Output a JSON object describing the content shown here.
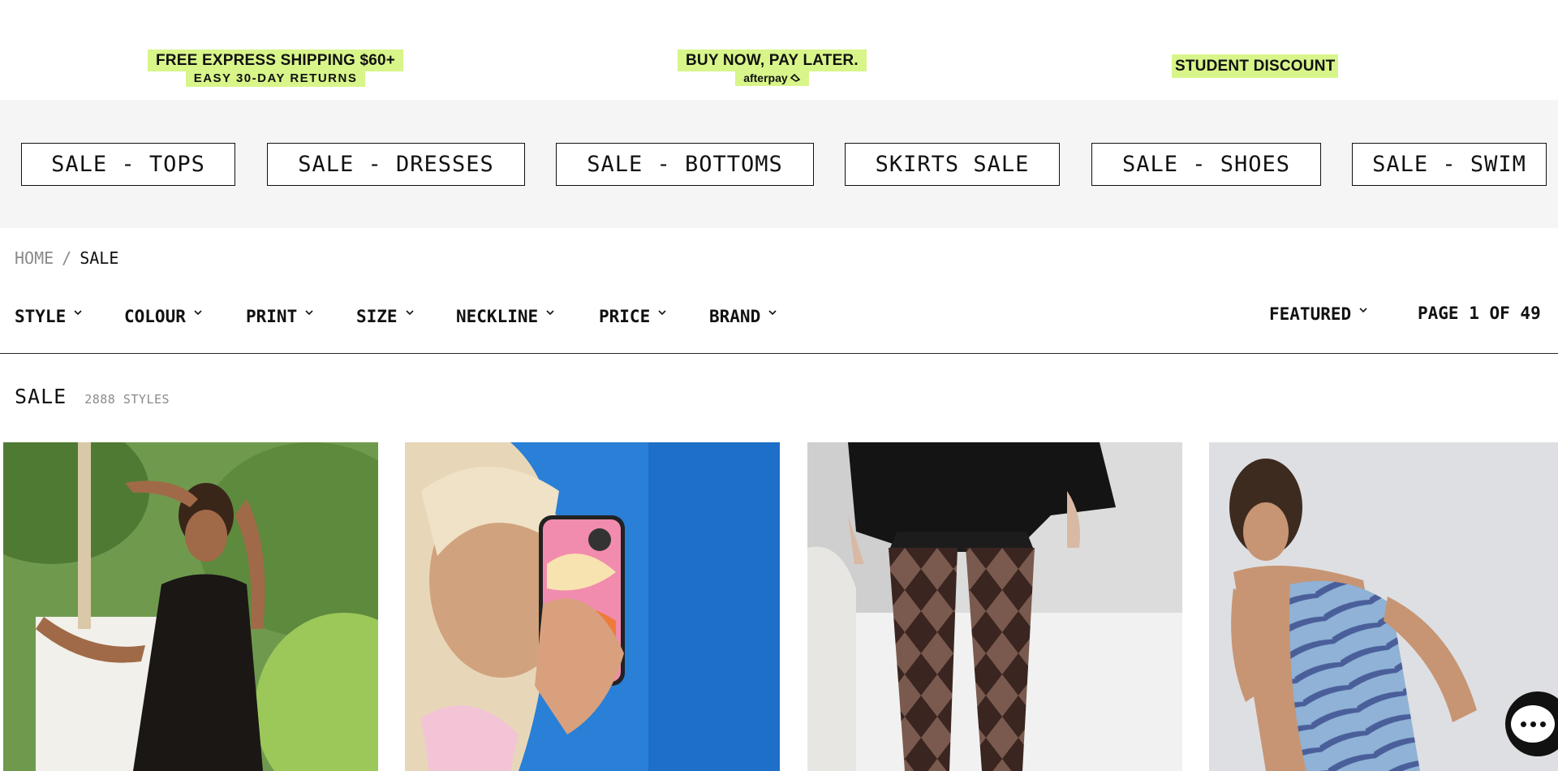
{
  "promo": {
    "shipping_line1": "FREE EXPRESS SHIPPING $60+",
    "shipping_line2": "EASY 30-DAY RETURNS",
    "bnpl_line1": "BUY NOW, PAY LATER.",
    "bnpl_line2": "afterpay",
    "student": "STUDENT DISCOUNT",
    "accent_color": "#d8f58a"
  },
  "categories": [
    {
      "label": "SALE - TOPS"
    },
    {
      "label": "SALE - DRESSES"
    },
    {
      "label": "SALE - BOTTOMS"
    },
    {
      "label": "SKIRTS SALE"
    },
    {
      "label": "SALE - SHOES"
    },
    {
      "label": "SALE - SWIM"
    }
  ],
  "breadcrumb": {
    "home": "HOME",
    "separator": "/",
    "current": "SALE"
  },
  "filters": [
    {
      "label": "STYLE"
    },
    {
      "label": "COLOUR"
    },
    {
      "label": "PRINT"
    },
    {
      "label": "SIZE"
    },
    {
      "label": "NECKLINE"
    },
    {
      "label": "PRICE"
    },
    {
      "label": "BRAND"
    }
  ],
  "sort": {
    "label": "FEATURED"
  },
  "pagination": {
    "label": "PAGE 1 OF 49"
  },
  "listing": {
    "title": "SALE",
    "count": "2888 STYLES"
  },
  "chat": {
    "icon": "chat-bubble-icon"
  }
}
